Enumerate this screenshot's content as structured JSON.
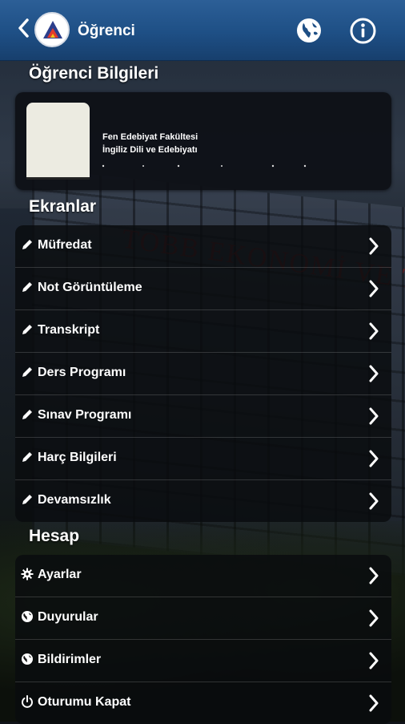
{
  "header": {
    "title": "Öğrenci",
    "back_icon": "chevron-left-icon",
    "globe_icon": "globe-icon",
    "info_icon": "info-icon"
  },
  "profile": {
    "heading": "Öğrenci Bilgileri",
    "faculty": "Fen Edebiyat Fakültesi",
    "department": "İngiliz Dili ve Edebiyatı"
  },
  "screens": {
    "heading": "Ekranlar",
    "items": [
      {
        "label": "Müfredat",
        "icon": "pencil-icon"
      },
      {
        "label": "Not Görüntüleme",
        "icon": "pencil-icon"
      },
      {
        "label": "Transkript",
        "icon": "pencil-icon"
      },
      {
        "label": "Ders Programı",
        "icon": "pencil-icon"
      },
      {
        "label": "Sınav Programı",
        "icon": "pencil-icon"
      },
      {
        "label": "Harç Bilgileri",
        "icon": "pencil-icon"
      },
      {
        "label": "Devamsızlık",
        "icon": "pencil-icon"
      }
    ]
  },
  "account": {
    "heading": "Hesap",
    "items": [
      {
        "label": "Ayarlar",
        "icon": "gear-icon"
      },
      {
        "label": "Duyurular",
        "icon": "globe-icon"
      },
      {
        "label": "Bildirimler",
        "icon": "globe-icon"
      },
      {
        "label": "Oturumu Kapat",
        "icon": "power-icon"
      }
    ]
  },
  "colors": {
    "header": "#1e4f85",
    "text": "#ffffff"
  }
}
